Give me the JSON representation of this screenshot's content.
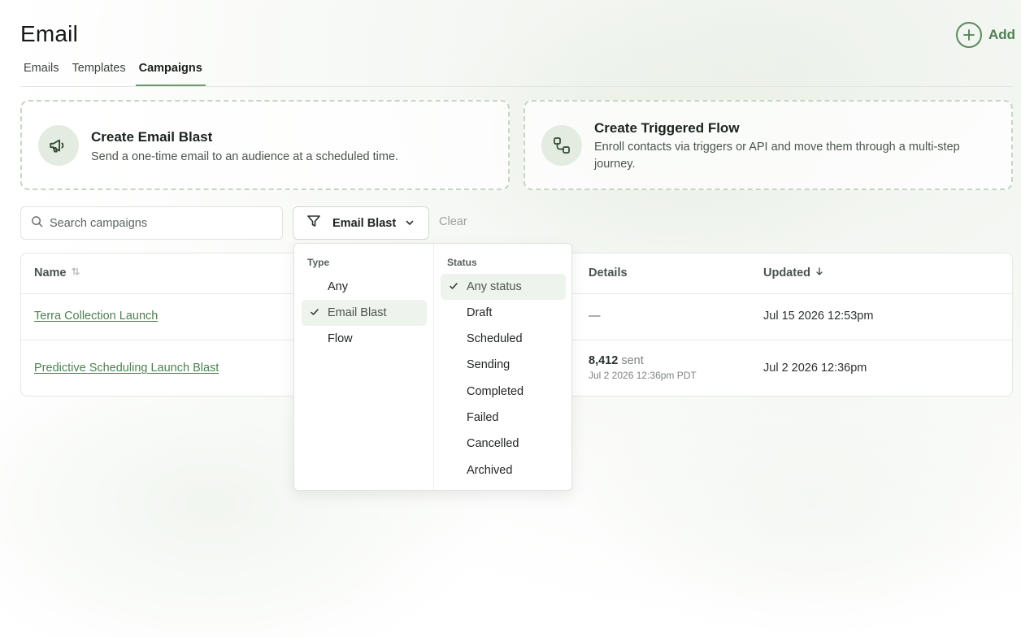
{
  "header": {
    "title": "Email",
    "add_label": "Add"
  },
  "tabs": [
    {
      "label": "Emails",
      "active": false
    },
    {
      "label": "Templates",
      "active": false
    },
    {
      "label": "Campaigns",
      "active": true
    }
  ],
  "cards": {
    "blast": {
      "title": "Create Email Blast",
      "description": "Send a one-time email to an audience at a scheduled time.",
      "icon": "megaphone-icon"
    },
    "flow": {
      "title": "Create Triggered Flow",
      "description": "Enroll contacts via triggers or API and move them through a multi-step journey.",
      "icon": "flow-icon"
    }
  },
  "toolbar": {
    "search_placeholder": "Search campaigns",
    "search_value": "",
    "filter_label": "Email Blast",
    "clear_label": "Clear"
  },
  "table": {
    "columns": {
      "name": "Name",
      "details": "Details",
      "updated": "Updated"
    },
    "rows": [
      {
        "name": "Terra Collection Launch",
        "details": "—",
        "updated": "Jul 15 2026 12:53pm"
      },
      {
        "name": "Predictive Scheduling Launch Blast",
        "sent_count": "8,412",
        "sent_label": "sent",
        "sent_time": "Jul 2 2026 12:36pm PDT",
        "updated": "Jul 2 2026 12:36pm"
      }
    ]
  },
  "filter_menu": {
    "type_heading": "Type",
    "type_options": [
      "Any",
      "Email Blast",
      "Flow"
    ],
    "type_selected": "Email Blast",
    "status_heading": "Status",
    "status_options": [
      "Any status",
      "Draft",
      "Scheduled",
      "Sending",
      "Completed",
      "Failed",
      "Cancelled",
      "Archived"
    ],
    "status_selected": "Any status"
  },
  "colors": {
    "accent": "#4f7f52",
    "card_border": "#c5d6c4",
    "selected_bg": "#eef3ed"
  }
}
